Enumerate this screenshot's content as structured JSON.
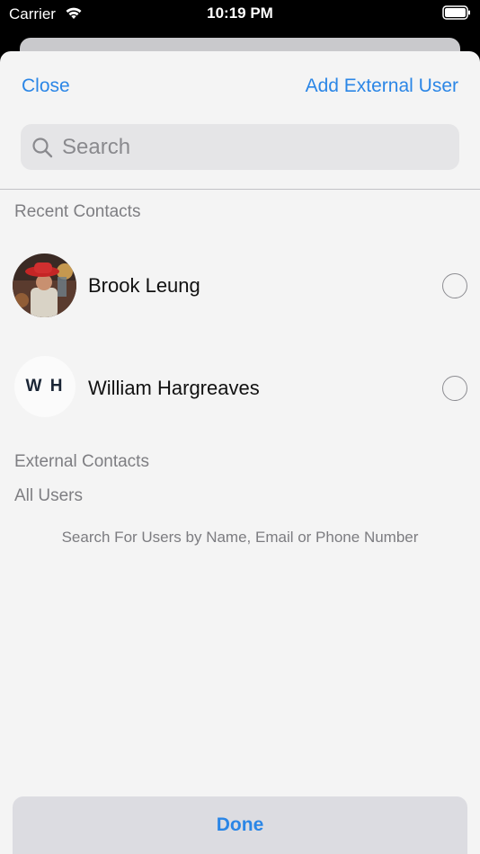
{
  "status_bar": {
    "carrier": "Carrier",
    "time": "10:19 PM",
    "wifi_icon": "wifi-icon",
    "battery_icon": "battery-icon"
  },
  "header": {
    "close_label": "Close",
    "add_label": "Add External User"
  },
  "search": {
    "placeholder": "Search",
    "value": "",
    "icon": "search-icon"
  },
  "sections": {
    "recent_title": "Recent Contacts",
    "external_title": "External Contacts",
    "all_users_title": "All Users"
  },
  "contacts": [
    {
      "name": "Brook Leung",
      "avatar": "photo",
      "selected": false
    },
    {
      "name": "William Hargreaves",
      "initials": "W H",
      "selected": false
    }
  ],
  "hint": "Search For Users by Name, Email or Phone Number",
  "footer": {
    "done_label": "Done"
  },
  "colors": {
    "accent": "#2b86e6",
    "sheet_bg": "#f4f4f4",
    "search_bg": "#e5e5e7",
    "secondary_text": "#7e7e82"
  }
}
